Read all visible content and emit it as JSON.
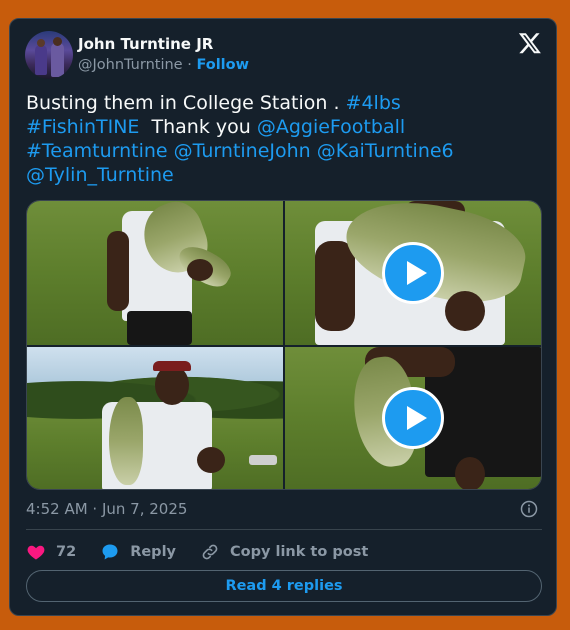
{
  "author": {
    "name": "John Turntine JR",
    "handle": "@JohnTurntine",
    "separator": " · ",
    "follow_label": "Follow"
  },
  "tweet": {
    "line1_text": "Busting them in College Station . ",
    "line1_tag": "#4lbs",
    "line2_tag": "#FishinTINE",
    "line2_text": "  Thank you ",
    "line2_mention": "@AggieFootball",
    "line3_tag": "#Teamturntine",
    "line3_mention1": "@TurntineJohn",
    "line3_mention2": "@KaiTurntine6",
    "line4_mention": "@Tylin_Turntine"
  },
  "media": {
    "count": 4,
    "videos": [
      2,
      4
    ]
  },
  "meta": {
    "timestamp": "4:52 AM · Jun 7, 2025"
  },
  "actions": {
    "like_count": "72",
    "reply_label": "Reply",
    "copy_label": "Copy link to post"
  },
  "replies_button": "Read 4 replies",
  "colors": {
    "background": "#c75c0c",
    "card": "#15202b",
    "accent": "#1d9bf0",
    "heart": "#f91880",
    "muted": "#8b98a5"
  },
  "icons": [
    "x-logo-icon",
    "info-icon",
    "heart-icon",
    "reply-bubble-icon",
    "link-icon",
    "play-icon"
  ]
}
